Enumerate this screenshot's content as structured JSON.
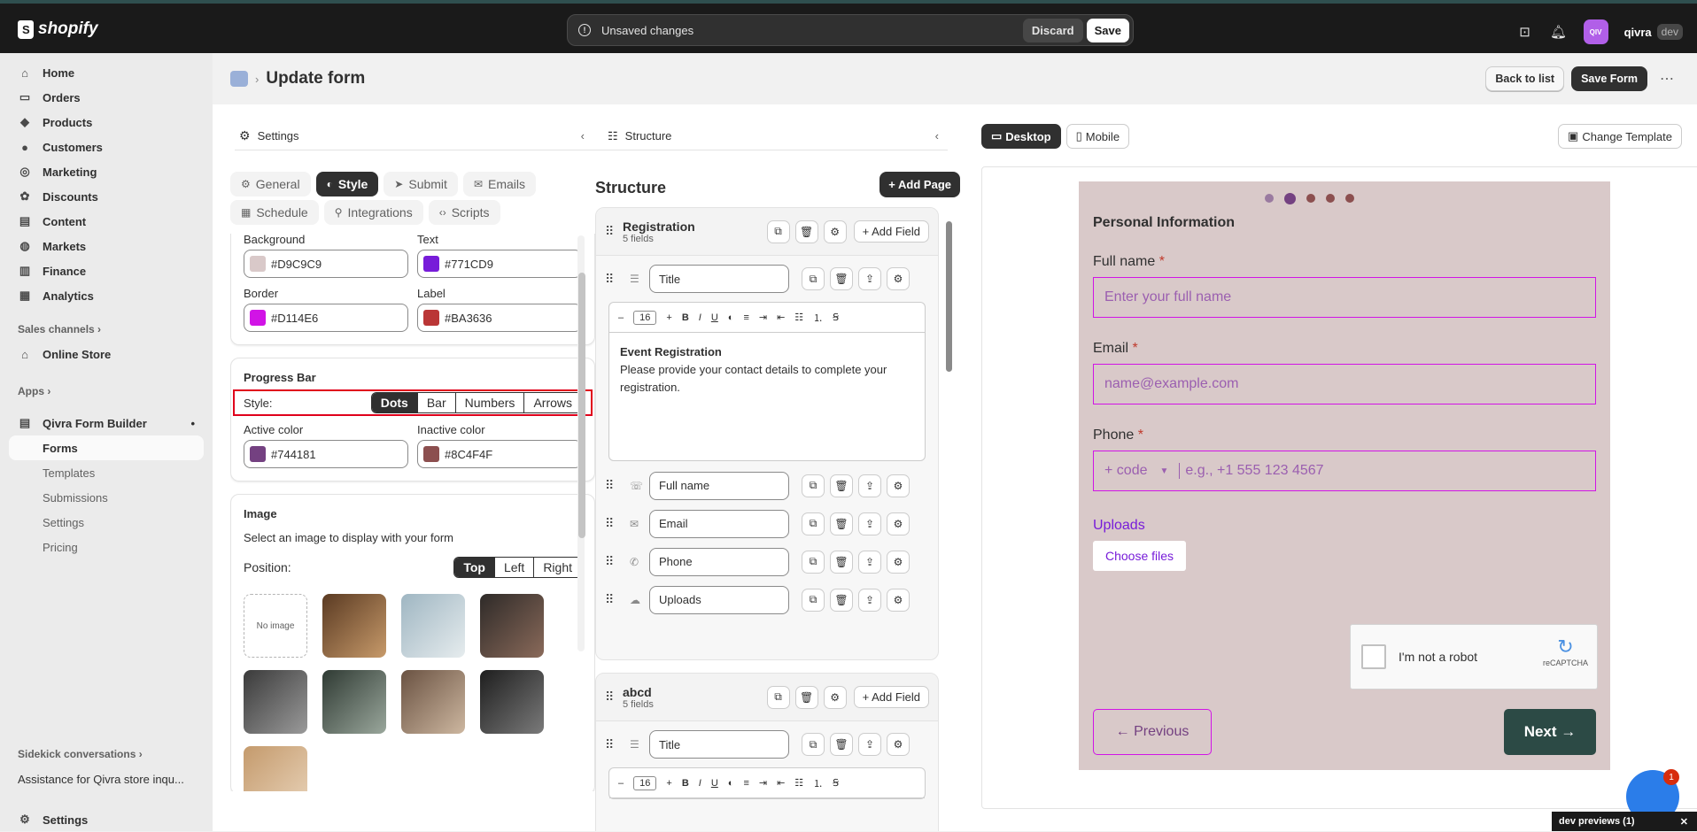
{
  "topbar": {
    "logo_text": "shopify",
    "unsaved_message": "Unsaved changes",
    "discard_label": "Discard",
    "save_label": "Save",
    "avatar_initials": "QIV",
    "store_name": "qivra",
    "store_tag": "dev"
  },
  "sidebar": {
    "items": [
      {
        "label": "Home",
        "icon": "home-icon"
      },
      {
        "label": "Orders",
        "icon": "orders-icon"
      },
      {
        "label": "Products",
        "icon": "tag-icon"
      },
      {
        "label": "Customers",
        "icon": "person-icon"
      },
      {
        "label": "Marketing",
        "icon": "target-icon"
      },
      {
        "label": "Discounts",
        "icon": "discount-icon"
      },
      {
        "label": "Content",
        "icon": "content-icon"
      },
      {
        "label": "Markets",
        "icon": "globe-icon"
      },
      {
        "label": "Finance",
        "icon": "bank-icon"
      },
      {
        "label": "Analytics",
        "icon": "chart-icon"
      }
    ],
    "sales_channels_label": "Sales channels",
    "online_store_label": "Online Store",
    "apps_label": "Apps",
    "app_name": "Qivra Form Builder",
    "app_subitems": [
      "Forms",
      "Templates",
      "Submissions",
      "Settings",
      "Pricing"
    ],
    "sidekick_label": "Sidekick conversations",
    "sidekick_item": "Assistance for Qivra store inqu...",
    "settings_label": "Settings"
  },
  "header": {
    "title": "Update form",
    "back_label": "Back to list",
    "save_form_label": "Save Form"
  },
  "settings": {
    "pane_title": "Settings",
    "tabs_row1": [
      "General",
      "Style",
      "Submit",
      "Emails"
    ],
    "tabs_row2": [
      "Schedule",
      "Integrations",
      "Scripts"
    ],
    "active_tab": "Style",
    "colors": {
      "background_label": "Background",
      "background_value": "#D9C9C9",
      "text_label": "Text",
      "text_value": "#771CD9",
      "border_label": "Border",
      "border_value": "#D114E6",
      "label_label": "Label",
      "label_value": "#BA3636"
    },
    "progress_bar": {
      "title": "Progress Bar",
      "style_label": "Style:",
      "options": [
        "Dots",
        "Bar",
        "Numbers",
        "Arrows"
      ],
      "selected": "Dots",
      "active_color_label": "Active color",
      "active_color_value": "#744181",
      "inactive_color_label": "Inactive color",
      "inactive_color_value": "#8C4F4F"
    },
    "image": {
      "title": "Image",
      "description": "Select an image to display with your form",
      "position_label": "Position:",
      "positions": [
        "Top",
        "Left",
        "Right"
      ],
      "selected_position": "Top",
      "no_image_label": "No image"
    }
  },
  "structure": {
    "pane_title": "Structure",
    "title": "Structure",
    "add_page_label": "Add Page",
    "add_field_label": "Add Field",
    "pages": [
      {
        "name": "Registration",
        "count": "5 fields",
        "fields": [
          "Title",
          "Full name",
          "Email",
          "Phone",
          "Uploads"
        ],
        "editor_size": "16",
        "editor_heading": "Event Registration",
        "editor_text": "Please provide your contact details to complete your registration."
      },
      {
        "name": "abcd",
        "count": "5 fields",
        "fields": [
          "Title"
        ],
        "editor_size": "16"
      }
    ]
  },
  "preview": {
    "desktop_label": "Desktop",
    "mobile_label": "Mobile",
    "change_template_label": "Change Template",
    "form": {
      "section_title": "Personal Information",
      "full_name_label": "Full name",
      "full_name_placeholder": "Enter your full name",
      "email_label": "Email",
      "email_placeholder": "name@example.com",
      "phone_label": "Phone",
      "phone_code_placeholder": "+ code",
      "phone_placeholder": "e.g., +1 555 123 4567",
      "required_mark": "*",
      "uploads_label": "Uploads",
      "choose_files_label": "Choose files",
      "captcha_label": "I'm not a robot",
      "captcha_brand": "reCAPTCHA",
      "previous_label": "← Previous",
      "next_label": "Next →",
      "progress": {
        "total_steps": 5,
        "current_step": 2
      }
    }
  },
  "footer": {
    "chat_badge": "1",
    "dev_previews_label": "dev previews (1)"
  }
}
